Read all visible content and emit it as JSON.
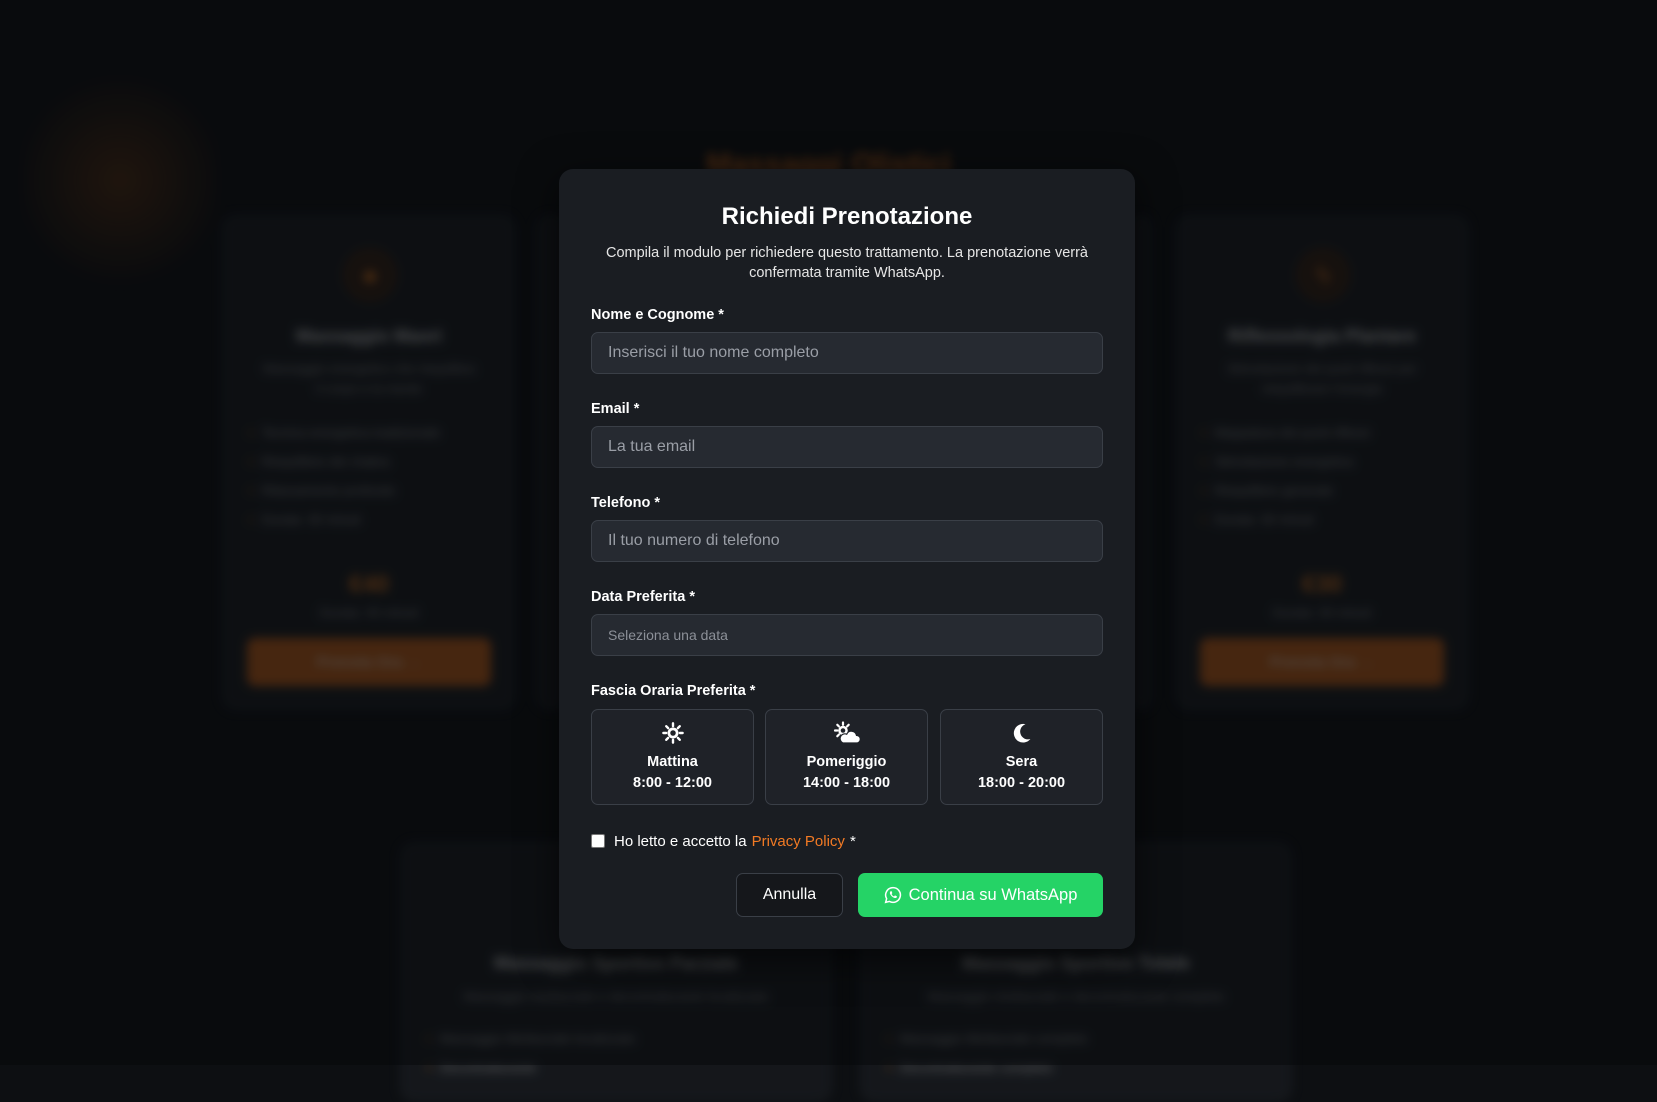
{
  "background": {
    "section_title": "Massaggi Olistici",
    "cards": [
      {
        "title": "Massaggio Maori",
        "description": "Massaggio energetico che riequilibra il corpo e la mente",
        "features": [
          "Tecnica energetica tradizionale",
          "Riequilibrio dei chakra",
          "Rilassamento profondo",
          "Durata: 30 minuti"
        ],
        "price": "€40",
        "duration": "Durata: 45 minuti",
        "button": "Prenota Ora →"
      },
      {
        "title": "Riflessologia Plantare",
        "description": "Stimolazione dei punti riflessi per riequilibrare l'energia",
        "features": [
          "Mappatura dei punti riflessi",
          "Stimolazione energetica",
          "Riequilibrio generale",
          "Durata: 30 minuti"
        ],
        "price": "€30",
        "duration": "Durata: 30 minuti",
        "button": "Prenota Ora →"
      },
      {
        "title": "Massaggio Sportivo Parziale",
        "description": "Massaggio miofasciale e decontratturante localizzato",
        "features": [
          "Massaggio Miofasciale localizzato",
          "Decontratturante"
        ]
      },
      {
        "title": "Massaggio Sportivo Totale",
        "description": "Massaggio miofasciale e decontratturante completo",
        "features": [
          "Massaggio Miofasciale completo",
          "Decontratturante completo"
        ]
      }
    ]
  },
  "modal": {
    "title": "Richiedi Prenotazione",
    "subtitle": "Compila il modulo per richiedere questo trattamento. La prenotazione verrà confermata tramite WhatsApp.",
    "fields": {
      "name": {
        "label": "Nome e Cognome *",
        "placeholder": "Inserisci il tuo nome completo",
        "value": ""
      },
      "email": {
        "label": "Email *",
        "placeholder": "La tua email",
        "value": ""
      },
      "phone": {
        "label": "Telefono *",
        "placeholder": "Il tuo numero di telefono",
        "value": ""
      },
      "date": {
        "label": "Data Preferita *",
        "placeholder": "Seleziona una data",
        "value": ""
      }
    },
    "time_slot": {
      "label": "Fascia Oraria Preferita *",
      "options": [
        {
          "name": "Mattina",
          "time": "8:00 - 12:00",
          "icon": "sun-icon"
        },
        {
          "name": "Pomeriggio",
          "time": "14:00 - 18:00",
          "icon": "sun-cloud-icon"
        },
        {
          "name": "Sera",
          "time": "18:00 - 20:00",
          "icon": "moon-icon"
        }
      ]
    },
    "privacy": {
      "prefix": "Ho letto e accetto la",
      "link": "Privacy Policy",
      "suffix": "*",
      "checked": false
    },
    "buttons": {
      "cancel": "Annulla",
      "whatsapp": "Continua su WhatsApp"
    },
    "colors": {
      "accent": "#f27a24",
      "whatsapp": "#25d366",
      "modal_bg": "#1a1d22"
    }
  }
}
